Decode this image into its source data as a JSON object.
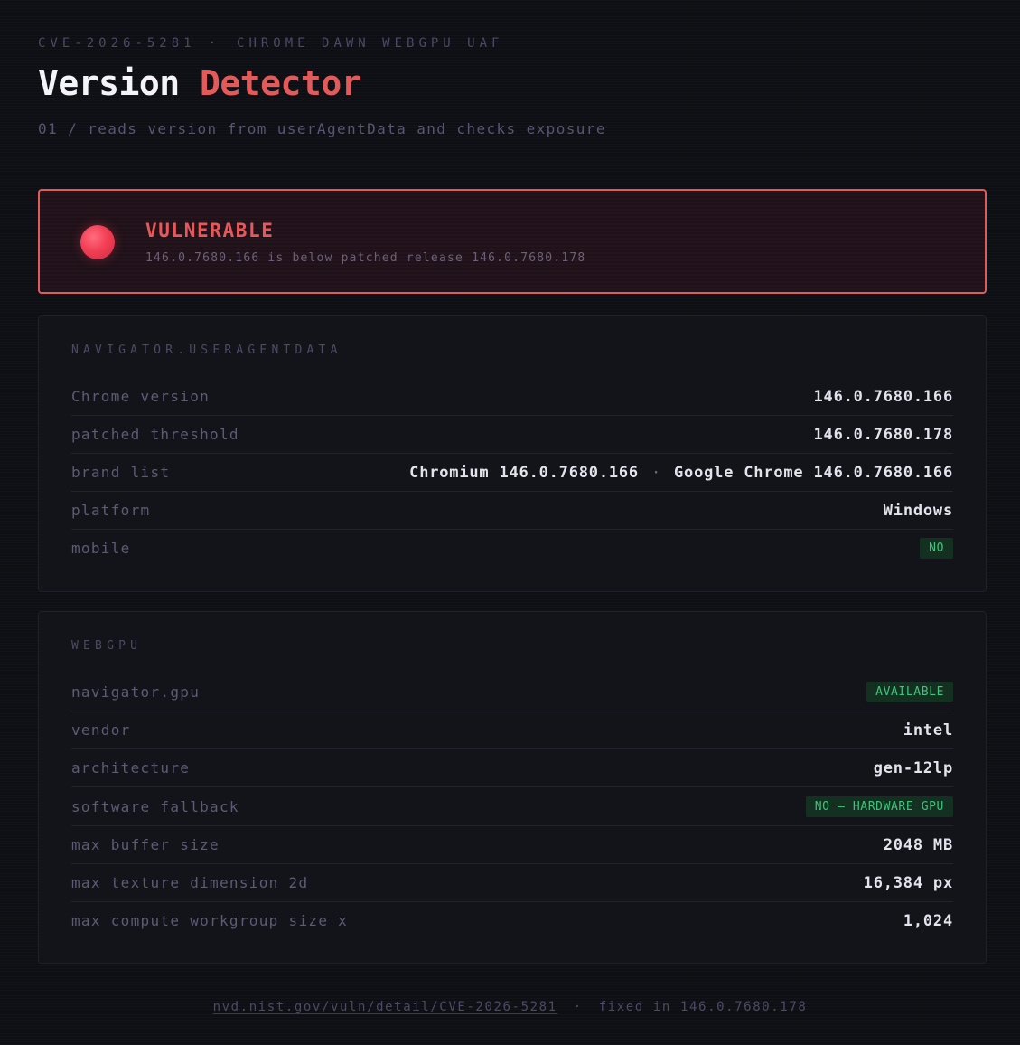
{
  "header": {
    "cve_id": "CVE-2026-5281",
    "separator": "·",
    "component": "CHROME DAWN WEBGPU UAF",
    "title_main": "Version",
    "title_accent": "Detector",
    "subtitle": "01 / reads version from userAgentData and checks exposure"
  },
  "status": {
    "label": "VULNERABLE",
    "detail": "146.0.7680.166 is below patched release 146.0.7680.178",
    "color": "#e05b5b"
  },
  "ua_panel": {
    "title": "NAVIGATOR.USERAGENTDATA",
    "rows": {
      "chrome_version": {
        "key": "Chrome version",
        "value": "146.0.7680.166"
      },
      "patched_threshold": {
        "key": "patched threshold",
        "value": "146.0.7680.178"
      },
      "brand_list": {
        "key": "brand list",
        "brand1": "Chromium 146.0.7680.166",
        "dot": "·",
        "brand2": "Google Chrome 146.0.7680.166"
      },
      "platform": {
        "key": "platform",
        "value": "Windows"
      },
      "mobile": {
        "key": "mobile",
        "value": "NO"
      }
    }
  },
  "gpu_panel": {
    "title": "WEBGPU",
    "rows": {
      "navigator_gpu": {
        "key": "navigator.gpu",
        "value": "AVAILABLE"
      },
      "vendor": {
        "key": "vendor",
        "value": "intel"
      },
      "architecture": {
        "key": "architecture",
        "value": "gen-12lp"
      },
      "software_fallback": {
        "key": "software fallback",
        "value": "NO — HARDWARE GPU"
      },
      "max_buffer_size": {
        "key": "max buffer size",
        "value": "2048 MB"
      },
      "max_texture_dimension_2d": {
        "key": "max texture dimension 2d",
        "value": "16,384 px"
      },
      "max_compute_workgroup_size_x": {
        "key": "max compute workgroup size x",
        "value": "1,024"
      }
    }
  },
  "footer": {
    "link": "nvd.nist.gov/vuln/detail/CVE-2026-5281",
    "separator": "·",
    "fixed_text": "fixed in 146.0.7680.178"
  },
  "colors": {
    "accent_red": "#e25a5a",
    "badge_green": "#3fc47a",
    "background": "#0e0f14"
  }
}
